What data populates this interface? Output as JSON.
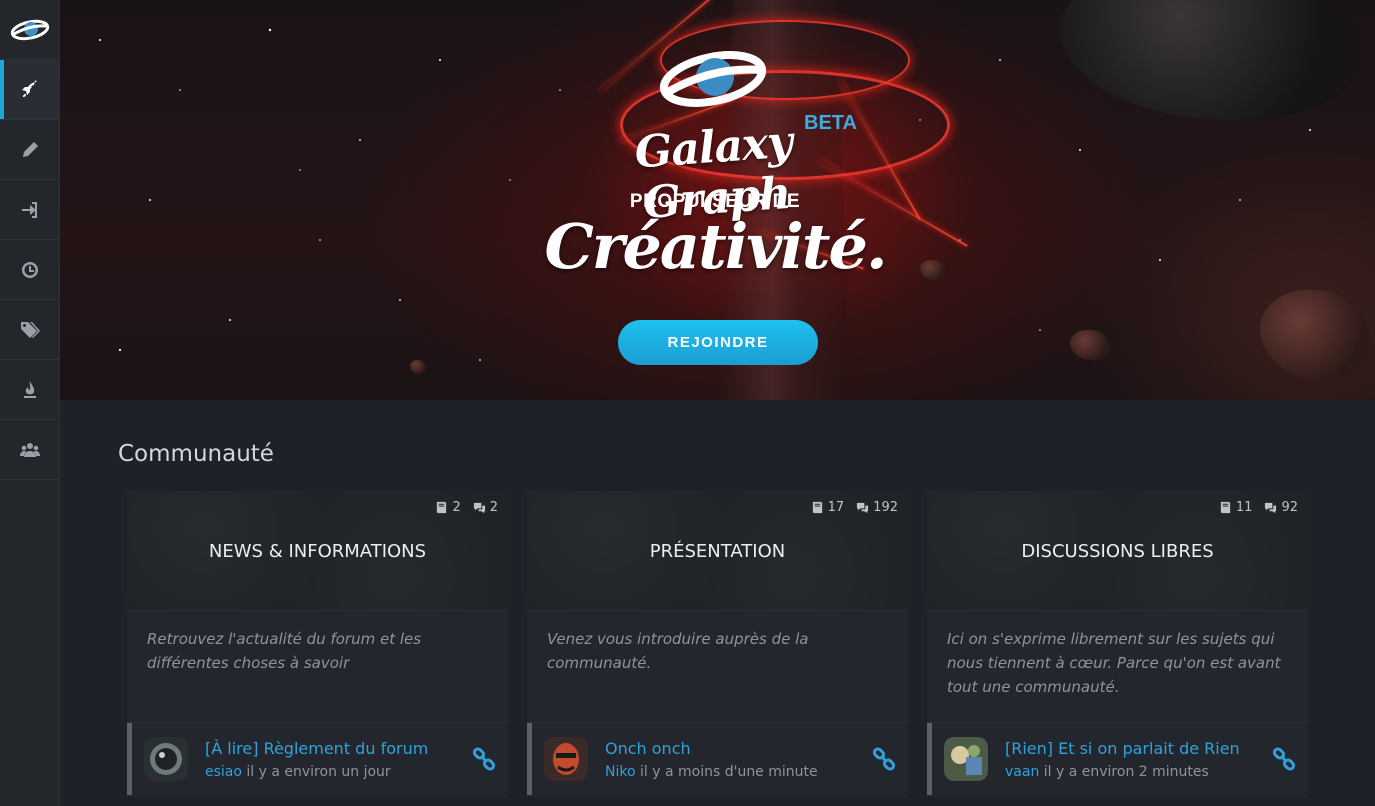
{
  "sidebar": {
    "logo_icon": "galaxy-graph-logo",
    "items": [
      {
        "icon": "rocket-icon",
        "active": true
      },
      {
        "icon": "pencil-icon",
        "active": false
      },
      {
        "icon": "sign-in-icon",
        "active": false
      },
      {
        "icon": "clock-icon",
        "active": false
      },
      {
        "icon": "tags-icon",
        "active": false
      },
      {
        "icon": "fire-icon",
        "active": false
      },
      {
        "icon": "users-icon",
        "active": false
      }
    ]
  },
  "hero": {
    "brand": "Galaxy Graph",
    "beta": "BETA",
    "tagline_small": "PROPULSEUR DE",
    "tagline_big": "Créativité.",
    "join_label": "REJOINDRE"
  },
  "community": {
    "title": "Communauté",
    "forums": [
      {
        "title": "NEWS & INFORMATIONS",
        "topics": "2",
        "posts": "2",
        "description": "Retrouvez l'actualité du forum et les différentes choses à savoir",
        "last_topic": "[À lire] Règlement du forum",
        "last_user": "esiao",
        "last_time": "il y a environ un jour"
      },
      {
        "title": "PRÉSENTATION",
        "topics": "17",
        "posts": "192",
        "description": "Venez vous introduire auprès de la communauté.",
        "last_topic": "Onch onch",
        "last_user": "Niko",
        "last_time": "il y a moins d'une minute"
      },
      {
        "title": "DISCUSSIONS LIBRES",
        "topics": "11",
        "posts": "92",
        "description": "Ici on s'exprime librement sur les sujets qui nous tiennent à cœur. Parce qu'on est avant tout une communauté.",
        "last_topic": "[Rien] Et si on parlait de Rien",
        "last_user": "vaan",
        "last_time": "il y a environ 2 minutes"
      }
    ]
  },
  "colors": {
    "accent": "#1ea8d8",
    "link": "#2fa2dc",
    "background": "#1d2128",
    "card": "#23262c",
    "sidebar": "#23262b"
  }
}
